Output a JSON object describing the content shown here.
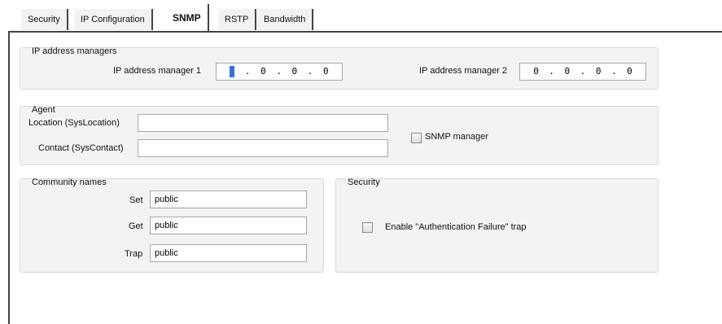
{
  "tabs": [
    "Security",
    "IP Configuration",
    "SNMP",
    "RSTP",
    "Bandwidth"
  ],
  "active_tab": "SNMP",
  "ip_managers": {
    "title": "IP address managers",
    "manager1": {
      "label": "IP address manager 1",
      "octets": [
        "",
        "0",
        "0",
        "0"
      ]
    },
    "manager2": {
      "label": "IP address manager 2",
      "octets": [
        "0",
        "0",
        "0",
        "0"
      ]
    }
  },
  "agent": {
    "title": "Agent",
    "location_label": "Location (SysLocation)",
    "location_value": "",
    "contact_label": "Contact (SysContact)",
    "contact_value": "",
    "snmp_manager_label": "SNMP manager",
    "snmp_manager_checked": false
  },
  "community": {
    "title": "Community names",
    "set_label": "Set",
    "set_value": "public",
    "get_label": "Get",
    "get_value": "public",
    "trap_label": "Trap",
    "trap_value": "public"
  },
  "security": {
    "title": "Security",
    "auth_trap_label": "Enable \"Authentication Failure\" trap",
    "auth_trap_checked": false
  }
}
